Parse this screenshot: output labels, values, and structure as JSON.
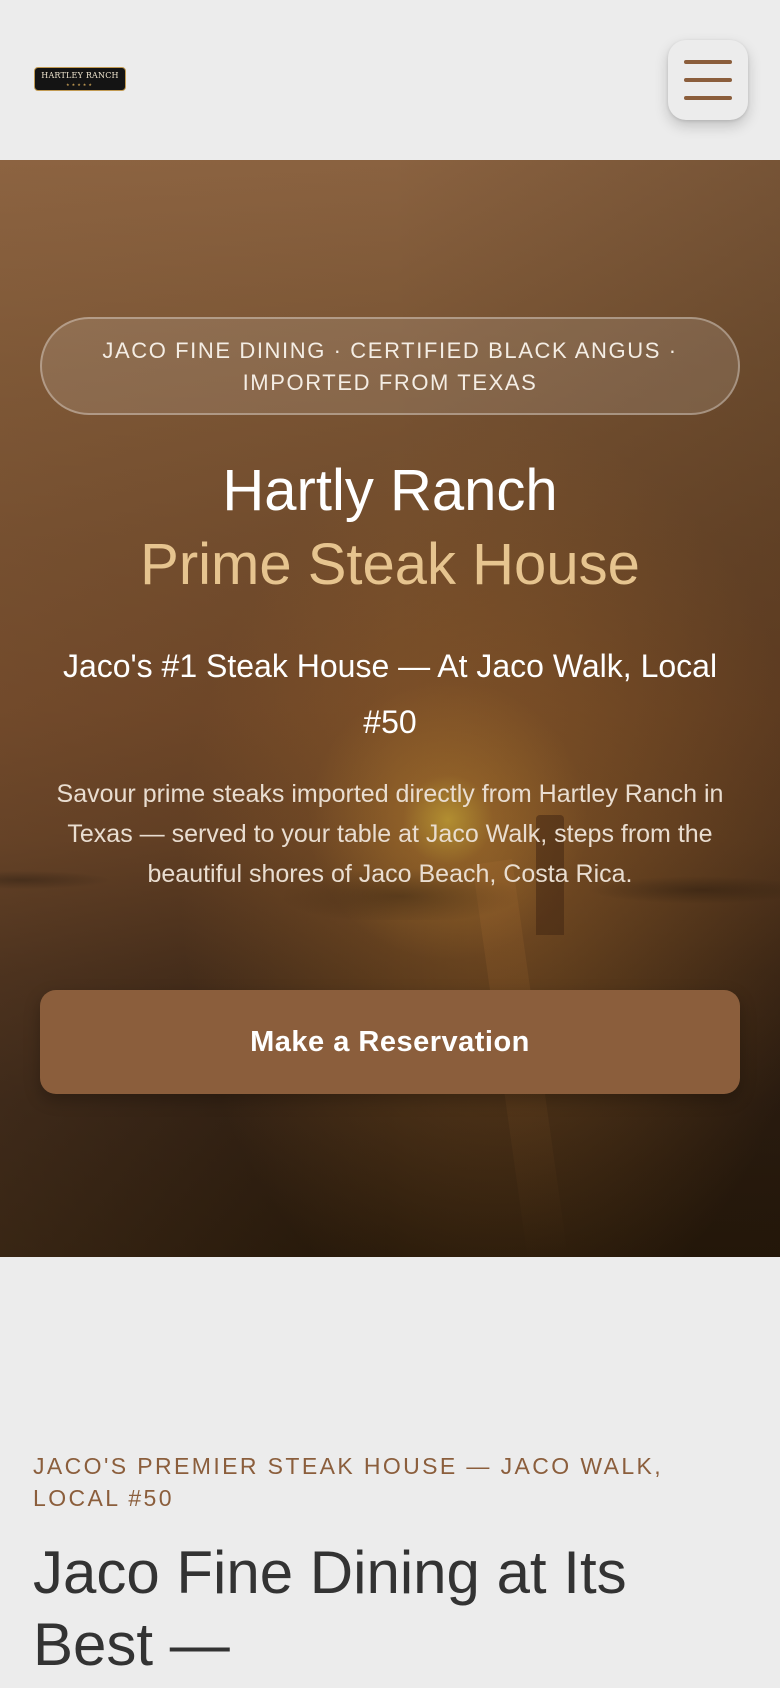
{
  "header": {
    "logo_text": "HARTLEY RANCH",
    "logo_stars": "★★★★★",
    "menu_icon": "hamburger-menu-icon",
    "accent_color": "#8b5e3c"
  },
  "hero": {
    "badge": "JACO FINE DINING · CERTIFIED BLACK ANGUS · IMPORTED FROM TEXAS",
    "title_line1": "Hartly Ranch",
    "title_line2": "Prime Steak House",
    "subtitle": "Jaco's #1 Steak House — At Jaco Walk, Local #50",
    "description": "Savour prime steaks imported directly from Hartley Ranch in Texas — served to your table at Jaco Walk, steps from the beautiful shores of Jaco Beach, Costa Rica.",
    "cta_label": "Make a Reservation",
    "title_accent_color": "#e6c48f"
  },
  "section": {
    "eyebrow": "JACO'S PREMIER STEAK HOUSE — JACO WALK, LOCAL #50",
    "title": "Jaco Fine Dining at Its Best —"
  }
}
